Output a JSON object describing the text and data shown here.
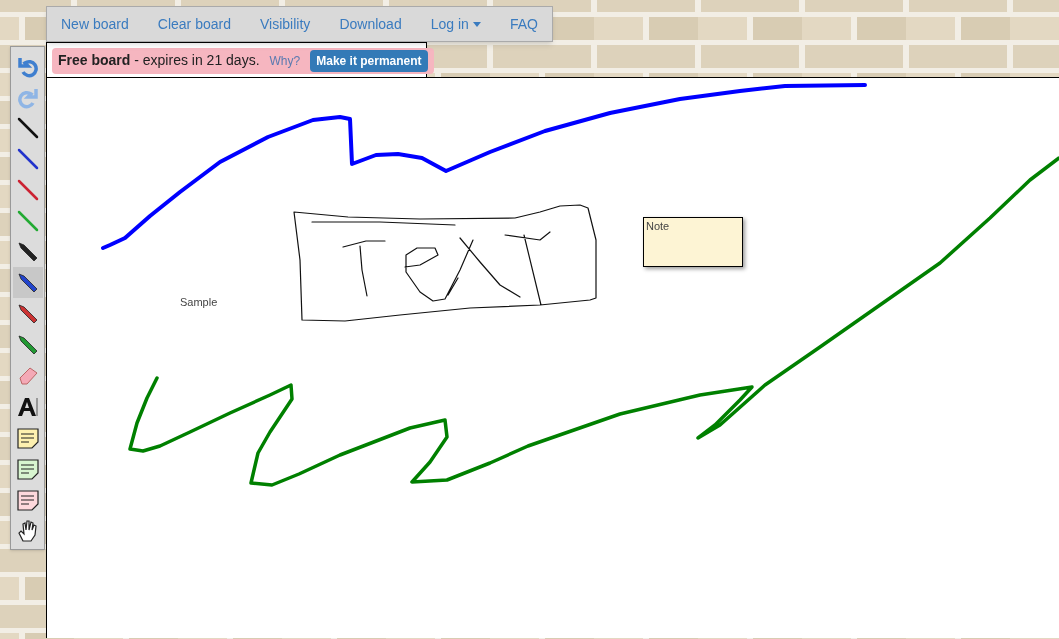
{
  "menu": [
    {
      "label": "New board"
    },
    {
      "label": "Clear board"
    },
    {
      "label": "Visibility"
    },
    {
      "label": "Download"
    },
    {
      "label": "Log in",
      "dropdown": true
    },
    {
      "label": "FAQ"
    }
  ],
  "notice": {
    "title": "Free board",
    "text": "- expires in 21 days.",
    "link": "Why?",
    "button": "Make it permanent"
  },
  "tools": [
    {
      "kind": "undo",
      "selected": false
    },
    {
      "kind": "redo",
      "selected": false
    },
    {
      "kind": "pen",
      "color": "#111111",
      "selected": false
    },
    {
      "kind": "pen",
      "color": "#2233cc",
      "selected": false
    },
    {
      "kind": "pen",
      "color": "#cc2233",
      "selected": false
    },
    {
      "kind": "pen",
      "color": "#22aa33",
      "selected": false
    },
    {
      "kind": "marker",
      "color": "#222222",
      "selected": false
    },
    {
      "kind": "marker",
      "color": "#2244cc",
      "selected": true
    },
    {
      "kind": "marker",
      "color": "#cc3333",
      "selected": false
    },
    {
      "kind": "marker",
      "color": "#229933",
      "selected": false
    },
    {
      "kind": "eraser",
      "selected": false
    },
    {
      "kind": "text",
      "selected": false
    },
    {
      "kind": "note",
      "color": "#fdf0b0",
      "selected": false
    },
    {
      "kind": "note",
      "color": "#d8f5d0",
      "selected": false
    },
    {
      "kind": "note",
      "color": "#fdd8dc",
      "selected": false
    },
    {
      "kind": "hand",
      "selected": false
    }
  ],
  "board": {
    "label": "Sample",
    "note": "Note",
    "strokes": [
      {
        "color": "#0000ff"
      },
      {
        "color": "#008000"
      },
      {
        "color": "#111111"
      }
    ]
  }
}
